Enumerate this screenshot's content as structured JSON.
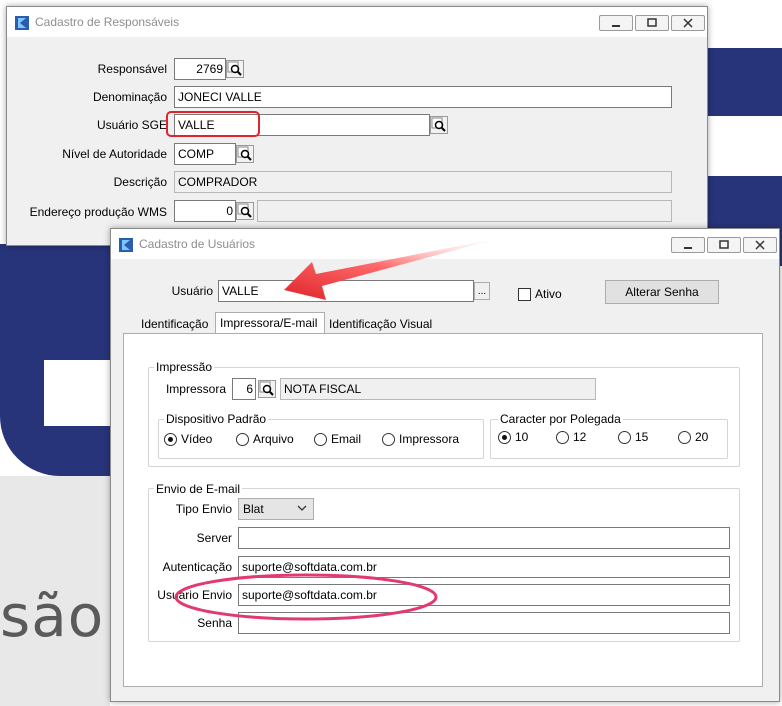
{
  "background": {
    "word": "são"
  },
  "resp_window": {
    "title": "Cadastro de Responsáveis",
    "fields": {
      "responsavel": {
        "label": "Responsável",
        "value": "2769"
      },
      "denominacao": {
        "label": "Denominação",
        "value": "JONECI VALLE"
      },
      "usuario_sge": {
        "label": "Usuário SGE",
        "value": "VALLE"
      },
      "nivel": {
        "label": "Nível de Autoridade",
        "value": "COMP"
      },
      "descricao": {
        "label": "Descrição",
        "value": "COMPRADOR"
      },
      "endereco_wms": {
        "label": "Endereço produção WMS",
        "value": "0"
      }
    }
  },
  "user_window": {
    "title": "Cadastro de Usuários",
    "usuario": {
      "label": "Usuário",
      "value": "VALLE",
      "ellipsis": "..."
    },
    "ativo_label": "Ativo",
    "alterar_senha": "Alterar Senha",
    "tabs": [
      "Identificação",
      "Impressora/E-mail",
      "Identificação Visual"
    ],
    "impressao": {
      "title": "Impressão",
      "impressora_label": "Impressora",
      "impressora_value": "6",
      "impressora_desc": "NOTA FISCAL",
      "dispositivo": {
        "title": "Dispositivo Padrão",
        "options": [
          "Vídeo",
          "Arquivo",
          "Email",
          "Impressora"
        ],
        "selected": "Vídeo"
      },
      "cpp": {
        "title": "Caracter por Polegada",
        "options": [
          "10",
          "12",
          "15",
          "20"
        ],
        "selected": "10"
      }
    },
    "email": {
      "title": "Envio de E-mail",
      "tipo_envio": {
        "label": "Tipo Envio",
        "value": "Blat"
      },
      "server": {
        "label": "Server",
        "value": ""
      },
      "autenticacao": {
        "label": "Autenticação",
        "value": "suporte@softdata.com.br"
      },
      "usuario_envio": {
        "label": "Usuário Envio",
        "value": "suporte@softdata.com.br"
      },
      "senha": {
        "label": "Senha",
        "value": ""
      }
    }
  },
  "colors": {
    "highlight_red": "#e0242b",
    "highlight_pink": "#e23a6e",
    "brand_blue": "#28347a"
  }
}
